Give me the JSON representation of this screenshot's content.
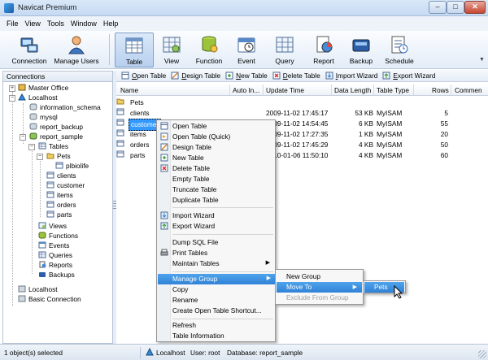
{
  "window": {
    "title": "Navicat Premium",
    "min": "–",
    "max": "□",
    "close": "✕"
  },
  "menubar": [
    "File",
    "View",
    "Tools",
    "Window",
    "Help"
  ],
  "toolbar": {
    "items": [
      {
        "label": "Connection",
        "icon": "connection-icon"
      },
      {
        "label": "Manage Users",
        "icon": "manage-users-icon"
      },
      {
        "label": "Table",
        "icon": "table-icon",
        "active": true
      },
      {
        "label": "View",
        "icon": "view-icon"
      },
      {
        "label": "Function",
        "icon": "function-icon"
      },
      {
        "label": "Event",
        "icon": "event-icon"
      },
      {
        "label": "Query",
        "icon": "query-icon"
      },
      {
        "label": "Report",
        "icon": "report-icon"
      },
      {
        "label": "Backup",
        "icon": "backup-icon"
      },
      {
        "label": "Schedule",
        "icon": "schedule-icon"
      }
    ],
    "more": "▼"
  },
  "connections": {
    "header": "Connections",
    "nodes": [
      "Master Office",
      "Localhost",
      "information_schema",
      "mysql",
      "report_backup",
      "report_sample",
      "Tables",
      "Pets",
      "plbiolife",
      "clients",
      "customer",
      "items",
      "orders",
      "parts",
      "Views",
      "Functions",
      "Events",
      "Queries",
      "Reports",
      "Backups",
      "Localhost",
      "Basic Connection"
    ]
  },
  "object_toolbar": {
    "buttons": [
      {
        "prefix": "",
        "underline": "O",
        "rest": "pen Table"
      },
      {
        "prefix": "",
        "underline": "D",
        "rest": "esign Table"
      },
      {
        "prefix": "",
        "underline": "N",
        "rest": "ew Table"
      },
      {
        "prefix": "",
        "underline": "D",
        "rest": "elete Table"
      },
      {
        "prefix": "",
        "underline": "I",
        "rest": "mport Wizard"
      },
      {
        "prefix": "",
        "underline": "E",
        "rest": "xport Wizard"
      }
    ]
  },
  "list": {
    "columns": [
      "Name",
      "Auto In...",
      "Update Time",
      "Data Length",
      "Table Type",
      "Rows",
      "Commen"
    ],
    "rows": [
      {
        "name": "Pets",
        "update": "",
        "length": "",
        "type": "",
        "rows": "",
        "folder": true
      },
      {
        "name": "clients",
        "update": "2009-11-02 17:45:17",
        "length": "53 KB",
        "type": "MyISAM",
        "rows": "5"
      },
      {
        "name": "customer",
        "update": "2009-11-02 14:54:45",
        "length": "6 KB",
        "type": "MyISAM",
        "rows": "55"
      },
      {
        "name": "items",
        "update": "2009-11-02 17:27:35",
        "length": "1 KB",
        "type": "MyISAM",
        "rows": "20"
      },
      {
        "name": "orders",
        "update": "2009-11-02 17:45:29",
        "length": "4 KB",
        "type": "MyISAM",
        "rows": "50"
      },
      {
        "name": "parts",
        "update": "2010-01-06 11:50:10",
        "length": "4 KB",
        "type": "MyISAM",
        "rows": "60"
      }
    ]
  },
  "context_menu": {
    "groups": [
      [
        "Open Table",
        "Open Table (Quick)",
        "Design Table",
        "New Table",
        "Delete Table",
        "Empty Table",
        "Truncate Table",
        "Duplicate Table"
      ],
      [
        "Import Wizard",
        "Export Wizard"
      ],
      [
        "Dump SQL File",
        "Print Tables",
        "Maintain Tables"
      ],
      [
        "Manage Group",
        "Copy",
        "Rename",
        "Create Open Table Shortcut..."
      ],
      [
        "Refresh",
        "Table Information"
      ]
    ],
    "submenu_arrow": "▶"
  },
  "manage_group_submenu": [
    "New Group",
    "Move To",
    "Exclude From Group"
  ],
  "move_to_submenu": [
    "Pets"
  ],
  "statusbar": {
    "selected": "1 object(s) selected",
    "connection": "Localhost",
    "user": "User: root",
    "database": "Database: report_sample"
  }
}
